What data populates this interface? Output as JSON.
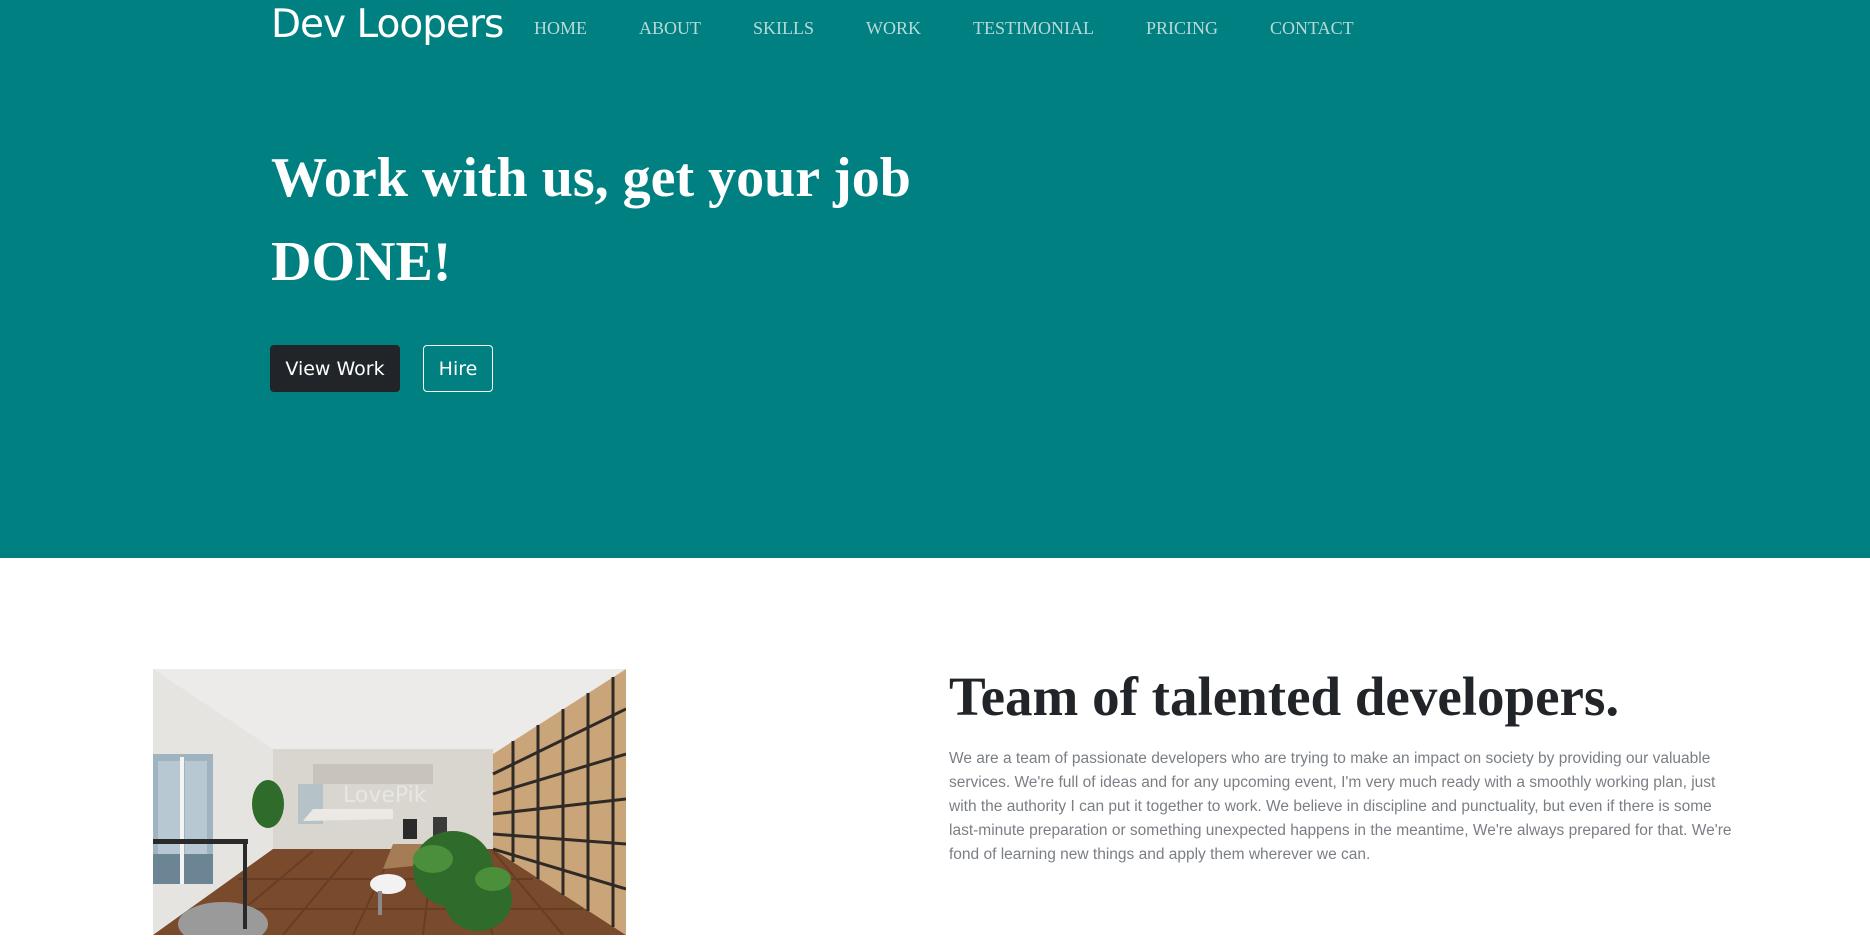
{
  "brand": "Dev Loopers",
  "nav": [
    "HOME",
    "ABOUT",
    "SKILLS",
    "WORK",
    "TESTIMONIAL",
    "PRICING",
    "CONTACT"
  ],
  "hero": {
    "title_line1": "Work with us, get your job",
    "title_line2": "DONE!",
    "view_work_label": "View Work",
    "hire_label": "Hire"
  },
  "about": {
    "image_watermark": "LovePik",
    "title": "Team of talented developers.",
    "text": "We are a team of passionate developers who are trying to make an impact on society by providing our valuable services. We're full of ideas and for any upcoming event, I'm very much ready with a smoothly working plan, just with the authority I can put it together to work. We believe in discipline and punctuality, but even if there is some last-minute preparation or something unexpected happens in the meantime, We're always prepared for that. We're fond of learning new things and apply them wherever we can."
  },
  "colors": {
    "hero_background": "#008080",
    "nav_link": "#b9d9d9",
    "dark_button": "#212529",
    "heading_dark": "#212529",
    "body_text": "#7a7f85"
  }
}
